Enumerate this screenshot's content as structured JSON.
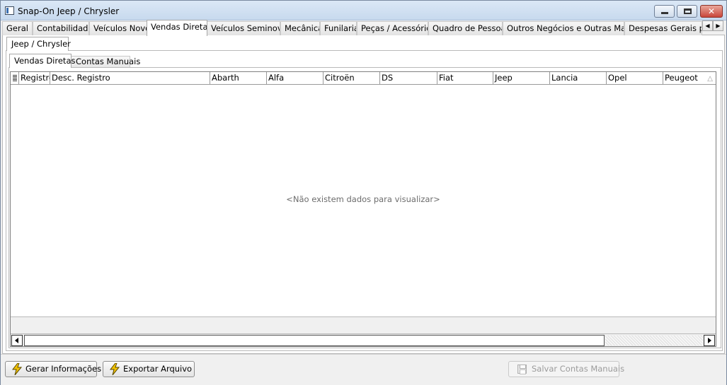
{
  "window": {
    "title": "Snap-On Jeep / Chrysler",
    "controls": {
      "minimize": "minimize-icon",
      "maximize": "maximize-icon",
      "close": "✕"
    }
  },
  "main_tabs": [
    {
      "label": "Geral"
    },
    {
      "label": "Contabilidade"
    },
    {
      "label": "Veículos Novos"
    },
    {
      "label": "Vendas Diretas",
      "active": true
    },
    {
      "label": "Veículos Seminovos"
    },
    {
      "label": "Mecânica"
    },
    {
      "label": "Funilaria"
    },
    {
      "label": "Peças / Acessórios"
    },
    {
      "label": "Quadro de Pessoas"
    },
    {
      "label": "Outros Negócios e Outras Marcas"
    },
    {
      "label": "Despesas Gerais por I"
    }
  ],
  "brand_tab": {
    "label": "Jeep / Chrysler"
  },
  "sub_tabs": [
    {
      "label": "Vendas Diretas",
      "active": true
    },
    {
      "label": "Contas Manuais"
    }
  ],
  "grid": {
    "columns": [
      "Registro",
      "Desc. Registro",
      "Abarth",
      "Alfa",
      "Citroën",
      "DS",
      "Fiat",
      "Jeep",
      "Lancia",
      "Opel",
      "Peugeot"
    ],
    "empty_message": "<Não existem dados para visualizar>"
  },
  "buttons": {
    "gerar": "Gerar Informações",
    "exportar": "Exportar Arquivo",
    "salvar": "Salvar Contas Manuais"
  },
  "colors": {
    "titlebar": "#c7d9ee",
    "close_button": "#c9463a",
    "bolt_icon": "#f2c200"
  }
}
